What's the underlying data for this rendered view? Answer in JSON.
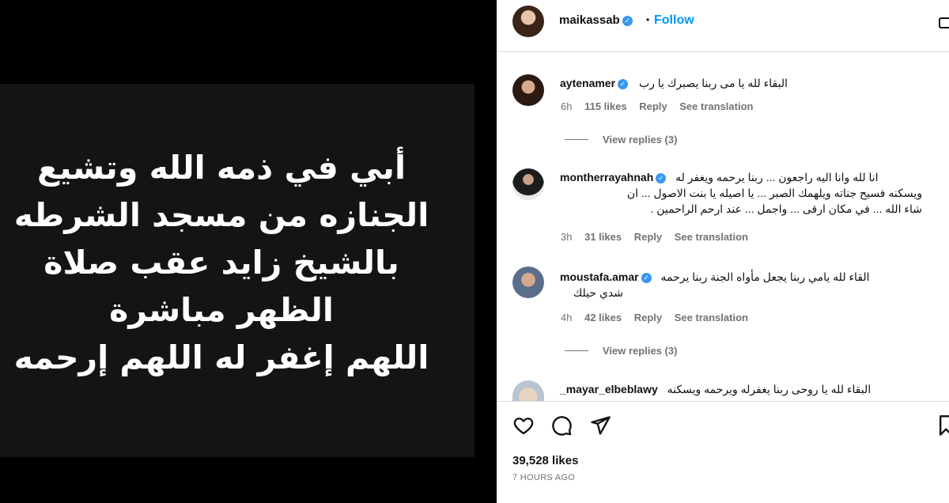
{
  "post_image": {
    "lines": [
      "أبي في ذمه الله وتشيع",
      "الجنازه من مسجد الشرطه",
      "بالشيخ زايد عقب صلاة",
      "الظهر مباشرة",
      "اللهم إغفر له اللهم إرحمه"
    ]
  },
  "header": {
    "username": "maikassab",
    "separator": "•",
    "follow_label": "Follow"
  },
  "comments": [
    {
      "username": "aytenamer",
      "verified": true,
      "text": "البقاء لله يا مى ربنا يصبرك يا رب",
      "time": "6h",
      "likes": "115 likes",
      "reply": "Reply",
      "translate": "See translation",
      "view_replies": "View replies (3)"
    },
    {
      "username": "montherrayahnah",
      "verified": true,
      "text_lines": [
        "انا لله وانا اليه راجعون ... ربنا يرحمه ويغفر له",
        "ويسكنه فسيح جناته ويلهمك الصبر ... يا اصيله يا بنت الاصول ... ان",
        "شاء الله ... في مكان ارقى ... واجمل ... عند ارحم الراحمين ."
      ],
      "time": "3h",
      "likes": "31 likes",
      "reply": "Reply",
      "translate": "See translation"
    },
    {
      "username": "moustafa.amar",
      "verified": true,
      "text_lines": [
        "القاء لله يامي ربنا يجعل مأواه الجنة ربنا يرحمه",
        "شدي حيلك"
      ],
      "time": "4h",
      "likes": "42 likes",
      "reply": "Reply",
      "translate": "See translation",
      "view_replies": "View replies (3)"
    },
    {
      "username": "_mayar_elbeblawy",
      "verified": false,
      "text": "البقاء لله يا روحى ربنا يغفرله ويرحمه ويسكنه"
    }
  ],
  "footer": {
    "likes": "39,528 likes",
    "time_ago": "7 HOURS AGO"
  },
  "icons": {
    "like": "heart-icon",
    "comment": "comment-icon",
    "share": "share-icon",
    "save": "bookmark-icon"
  },
  "colors": {
    "follow": "#0095f6",
    "verified": "#3897f0",
    "meta_gray": "#737373"
  }
}
